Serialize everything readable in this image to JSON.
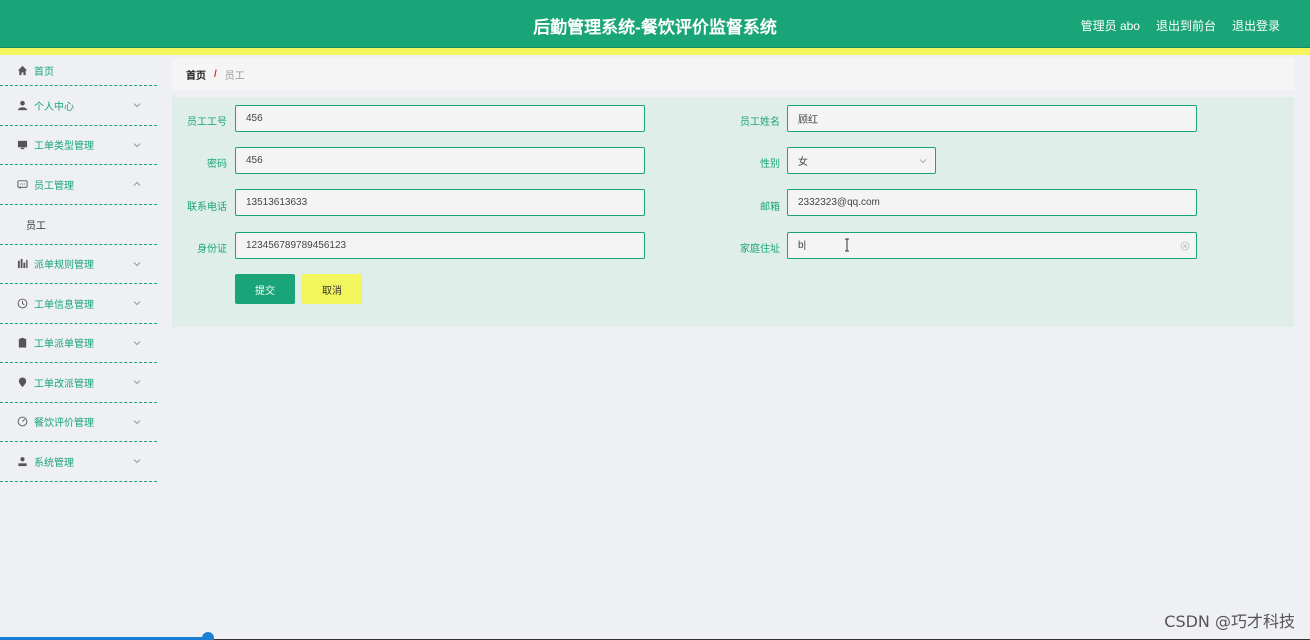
{
  "header": {
    "title": "后勤管理系统-餐饮评价监督系统",
    "admin_label": "管理员 abo",
    "back_label": "退出到前台",
    "logout_label": "退出登录"
  },
  "sidebar": {
    "items": [
      {
        "label": "首页",
        "icon": "home-icon"
      },
      {
        "label": "个人中心",
        "icon": "user-icon"
      },
      {
        "label": "工单类型管理",
        "icon": "monitor-icon"
      },
      {
        "label": "员工管理",
        "icon": "chat-icon"
      },
      {
        "label": "派单规则管理",
        "icon": "chart-icon"
      },
      {
        "label": "工单信息管理",
        "icon": "clock-icon"
      },
      {
        "label": "工单派单管理",
        "icon": "clipboard-icon"
      },
      {
        "label": "工单改派管理",
        "icon": "location-icon"
      },
      {
        "label": "餐饮评价管理",
        "icon": "gauge-icon"
      },
      {
        "label": "系统管理",
        "icon": "person-icon"
      }
    ],
    "sub_item": "员工"
  },
  "breadcrumb": {
    "home": "首页",
    "separator": "/",
    "current": "员工"
  },
  "form": {
    "emp_no_label": "员工工号",
    "emp_no_value": "456",
    "emp_name_label": "员工姓名",
    "emp_name_value": "顾红",
    "password_label": "密码",
    "password_value": "456",
    "gender_label": "性别",
    "gender_value": "女",
    "phone_label": "联系电话",
    "phone_value": "13513613633",
    "email_label": "邮箱",
    "email_value": "2332323@qq.com",
    "id_label": "身份证",
    "id_value": "123456789789456123",
    "address_label": "家庭住址",
    "address_value": "b|",
    "submit_label": "提交",
    "cancel_label": "取消"
  },
  "watermark": "CSDN @巧才科技",
  "colors": {
    "primary": "#1aa578",
    "accent": "#f2f55b",
    "panel": "#dfeee9"
  }
}
